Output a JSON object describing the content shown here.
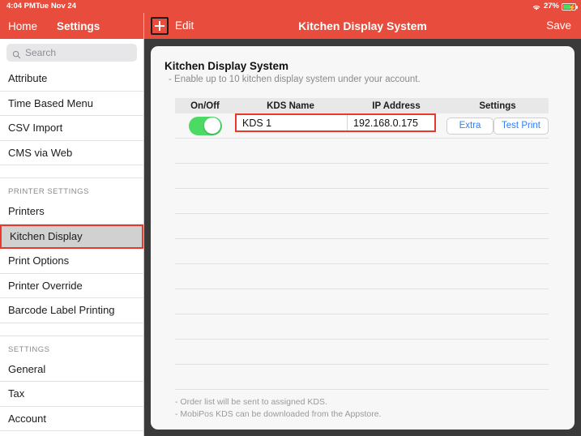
{
  "statusbar": {
    "time": "4:04 PM",
    "date": "Tue Nov 24",
    "battery_percent": "27%",
    "wifi_icon": "wifi-icon",
    "battery_icon": "battery-charging-icon"
  },
  "sidebar": {
    "home_label": "Home",
    "settings_label": "Settings",
    "search_placeholder": "Search",
    "search_value": "",
    "search_icon": "search-icon",
    "items": [
      {
        "label": "Attribute",
        "type": "item",
        "selected": false
      },
      {
        "label": "Time Based Menu",
        "type": "item",
        "selected": false
      },
      {
        "label": "CSV Import",
        "type": "item",
        "selected": false
      },
      {
        "label": "CMS via Web",
        "type": "item",
        "selected": false
      },
      {
        "label": "PRINTER SETTINGS",
        "type": "section"
      },
      {
        "label": "Printers",
        "type": "item",
        "selected": false
      },
      {
        "label": "Kitchen Display",
        "type": "item",
        "selected": true
      },
      {
        "label": "Print Options",
        "type": "item",
        "selected": false
      },
      {
        "label": "Printer Override",
        "type": "item",
        "selected": false
      },
      {
        "label": "Barcode Label Printing",
        "type": "item",
        "selected": false
      },
      {
        "label": "SETTINGS",
        "type": "section"
      },
      {
        "label": "General",
        "type": "item",
        "selected": false
      },
      {
        "label": "Tax",
        "type": "item",
        "selected": false
      },
      {
        "label": "Account",
        "type": "item",
        "selected": false
      }
    ]
  },
  "navbar": {
    "add_icon": "plus-square-icon",
    "edit_label": "Edit",
    "title": "Kitchen Display System",
    "save_label": "Save"
  },
  "card": {
    "title": "Kitchen Display System",
    "subtitle": "- Enable up to 10 kitchen display system under your account.",
    "columns": {
      "onoff": "On/Off",
      "name": "KDS Name",
      "ip": "IP Address",
      "settings": "Settings"
    },
    "row": {
      "enabled": true,
      "name_value": "KDS 1",
      "ip_value": "192.168.0.175",
      "extra_label": "Extra",
      "test_print_label": "Test Print"
    },
    "empty_rows": 10,
    "notes": [
      "- Order list will be sent to assigned KDS.",
      "- MobiPos KDS can be downloaded from the Appstore."
    ]
  },
  "colors": {
    "accent_red": "#e74c3c",
    "highlight_red": "#e8392b",
    "toggle_green": "#4cd964",
    "link_blue": "#2f7ff7",
    "window_bg": "#3a3a3a",
    "card_bg": "#f7f7f7"
  }
}
